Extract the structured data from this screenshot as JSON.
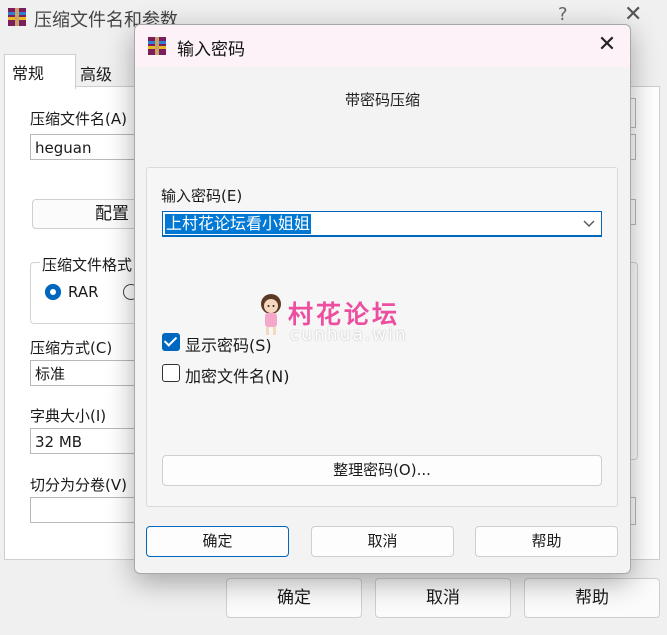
{
  "background_window": {
    "title": "压缩文件名和参数",
    "help_glyph": "?",
    "close_glyph": "✕",
    "tabs": [
      {
        "label": "常规",
        "active": true
      },
      {
        "label": "高级",
        "active": false
      }
    ],
    "archive_name_label": "压缩文件名(A)",
    "archive_name_value": "heguan",
    "profiles_button": "配置",
    "format_group_label": "压缩文件格式",
    "format_options": [
      {
        "label": "RAR",
        "selected": true
      }
    ],
    "method_label": "压缩方式(C)",
    "method_value": "标准",
    "dict_label": "字典大小(I)",
    "dict_value": "32 MB",
    "split_label": "切分为分卷(V)",
    "buttons": {
      "ok": "确定",
      "cancel": "取消",
      "help": "帮助"
    }
  },
  "dialog": {
    "title": "输入密码",
    "close_glyph": "✕",
    "subtitle": "带密码压缩",
    "password_label": "输入密码(E)",
    "password_value": "上村花论坛看小姐姐",
    "show_password": {
      "label": "显示密码(S)",
      "checked": true
    },
    "encrypt_names": {
      "label": "加密文件名(N)",
      "checked": false
    },
    "organize_button": "整理密码(O)...",
    "buttons": {
      "ok": "确定",
      "cancel": "取消",
      "help": "帮助"
    }
  },
  "watermark": {
    "text": "村花论坛",
    "subtext": "cunhua.win"
  },
  "colors": {
    "accent": "#0067c0",
    "selection": "#0078d4",
    "dialog_titlebar": "#fdf2f8",
    "watermark": "#ec4fa0"
  },
  "icons": [
    "winrar-icon",
    "close-icon",
    "chevron-down-icon",
    "check-icon",
    "radio-icon",
    "mascot-icon"
  ]
}
